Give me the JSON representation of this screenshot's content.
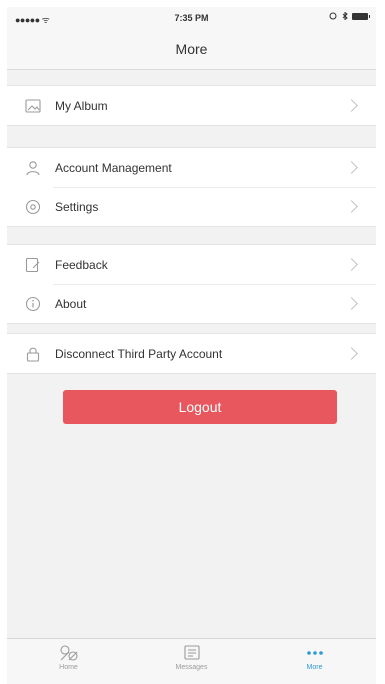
{
  "status_bar": {
    "signal": "●●●●● ᯤ",
    "time": "7:35 PM"
  },
  "nav": {
    "title": "More"
  },
  "menu": {
    "my_album": "My Album",
    "account_management": "Account Management",
    "settings": "Settings",
    "feedback": "Feedback",
    "about": "About",
    "disconnect": "Disconnect Third Party Account"
  },
  "logout_label": "Logout",
  "tabs": {
    "home": "Home",
    "messages": "Messages",
    "more": "More"
  },
  "colors": {
    "accent": "#2d9ad8",
    "logout": "#e8575d",
    "background": "#f2f2f2"
  }
}
